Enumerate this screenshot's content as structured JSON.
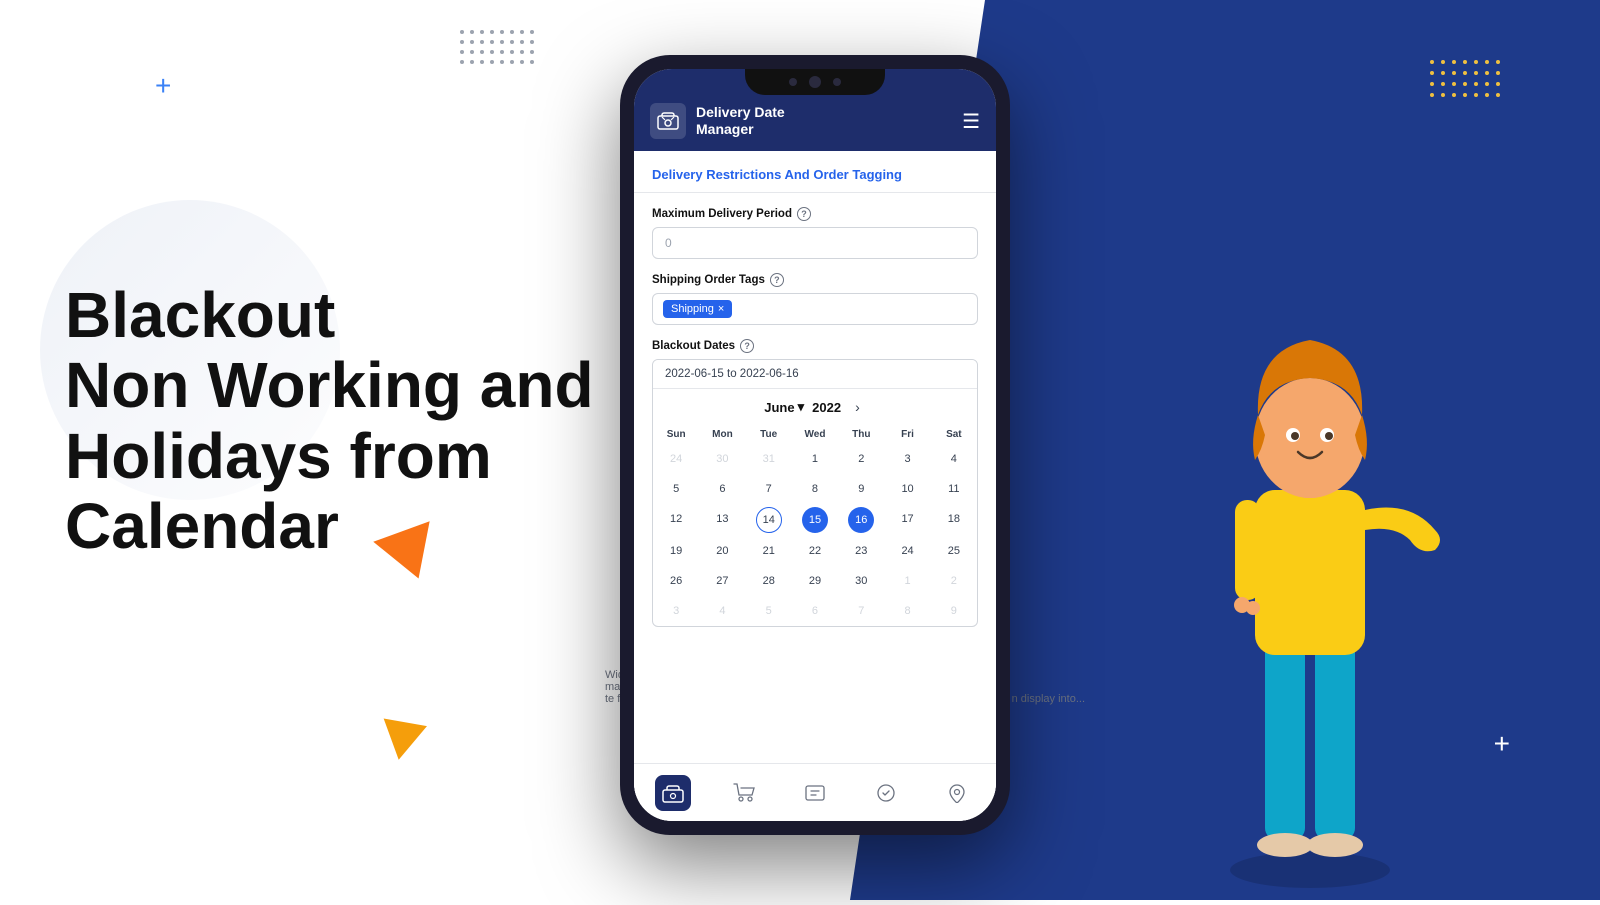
{
  "background": {
    "left_color": "#ffffff",
    "right_color": "#1e3a8a"
  },
  "decorative": {
    "plus_blue": "+",
    "plus_white": "+",
    "triangle_orange": "",
    "triangle_yellow": ""
  },
  "left_text": {
    "heading_line1": "Blackout",
    "heading_line2": "Non Working and",
    "heading_line3": "Holidays from",
    "heading_line4": "Calendar"
  },
  "app": {
    "header": {
      "title_line1": "Delivery Date",
      "title_line2": "Manager",
      "hamburger_label": "☰"
    },
    "section_title": "Delivery Restrictions And Order Tagging",
    "fields": {
      "max_delivery_label": "Maximum Delivery Period",
      "max_delivery_value": "0",
      "max_delivery_placeholder": "0",
      "shipping_tags_label": "Shipping Order Tags",
      "tag_value": "Shipping",
      "blackout_dates_label": "Blackout Dates",
      "date_range_value": "2022-06-15 to 2022-06-16"
    },
    "calendar": {
      "month": "June",
      "month_arrow": "▾",
      "year": "2022",
      "next_arrow": "›",
      "days_of_week": [
        "Sun",
        "Mon",
        "Tue",
        "Wed",
        "Thu",
        "Fri",
        "Sat"
      ],
      "weeks": [
        [
          {
            "day": "24",
            "type": "other-month"
          },
          {
            "day": "30",
            "type": "other-month"
          },
          {
            "day": "31",
            "type": "other-month"
          },
          {
            "day": "1",
            "type": "normal"
          },
          {
            "day": "2",
            "type": "normal"
          },
          {
            "day": "3",
            "type": "normal"
          },
          {
            "day": "4",
            "type": "normal"
          }
        ],
        [
          {
            "day": "5",
            "type": "normal"
          },
          {
            "day": "6",
            "type": "normal"
          },
          {
            "day": "7",
            "type": "normal"
          },
          {
            "day": "8",
            "type": "normal"
          },
          {
            "day": "9",
            "type": "normal"
          },
          {
            "day": "10",
            "type": "normal"
          },
          {
            "day": "11",
            "type": "normal"
          }
        ],
        [
          {
            "day": "12",
            "type": "normal"
          },
          {
            "day": "13",
            "type": "normal"
          },
          {
            "day": "14",
            "type": "today"
          },
          {
            "day": "15",
            "type": "selected-start"
          },
          {
            "day": "16",
            "type": "selected-end"
          },
          {
            "day": "17",
            "type": "normal"
          },
          {
            "day": "18",
            "type": "normal"
          }
        ],
        [
          {
            "day": "19",
            "type": "normal"
          },
          {
            "day": "20",
            "type": "normal"
          },
          {
            "day": "21",
            "type": "normal"
          },
          {
            "day": "22",
            "type": "normal"
          },
          {
            "day": "23",
            "type": "normal"
          },
          {
            "day": "24",
            "type": "normal"
          },
          {
            "day": "25",
            "type": "normal"
          }
        ],
        [
          {
            "day": "26",
            "type": "normal"
          },
          {
            "day": "27",
            "type": "normal"
          },
          {
            "day": "28",
            "type": "normal"
          },
          {
            "day": "29",
            "type": "normal"
          },
          {
            "day": "30",
            "type": "normal"
          },
          {
            "day": "1",
            "type": "other-month"
          },
          {
            "day": "2",
            "type": "other-month"
          }
        ],
        [
          {
            "day": "3",
            "type": "other-month"
          },
          {
            "day": "4",
            "type": "other-month"
          },
          {
            "day": "5",
            "type": "other-month"
          },
          {
            "day": "6",
            "type": "other-month"
          },
          {
            "day": "7",
            "type": "other-month"
          },
          {
            "day": "8",
            "type": "other-month"
          },
          {
            "day": "9",
            "type": "other-month"
          }
        ]
      ]
    },
    "bottom_nav": [
      {
        "icon": "🚚",
        "active": true
      },
      {
        "icon": "🛒",
        "active": false
      },
      {
        "icon": "📊",
        "active": false
      },
      {
        "icon": "🚗",
        "active": false
      },
      {
        "icon": "🔔",
        "active": false
      }
    ]
  },
  "background_card_text": {
    "left": "Widget",
    "left2": "manag...",
    "left3": "te fro...",
    "right": "n display into..."
  }
}
